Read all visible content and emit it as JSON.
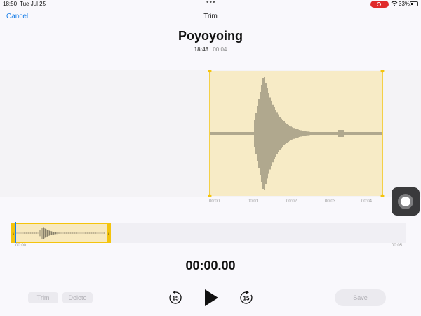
{
  "status": {
    "time": "18:50",
    "date": "Tue Jul 25",
    "battery": "33%"
  },
  "nav": {
    "cancel_label": "Cancel",
    "title": "Trim"
  },
  "recording": {
    "title": "Poyoyoing",
    "time": "18:46",
    "duration": "00:04"
  },
  "waveform": {
    "ticks": [
      "00:00",
      "00:01",
      "00:02",
      "00:03",
      "00:04"
    ],
    "selection_color": "#f7ebc6"
  },
  "overview": {
    "start_label": "00:00",
    "end_label": "00:05"
  },
  "timecode": "00:00.00",
  "toolbar": {
    "trim_label": "Trim",
    "delete_label": "Delete",
    "save_label": "Save",
    "skip_seconds": "15"
  },
  "colors": {
    "accent": "#1a7fe8",
    "handle": "#f4c40d",
    "record": "#e02a2a"
  }
}
